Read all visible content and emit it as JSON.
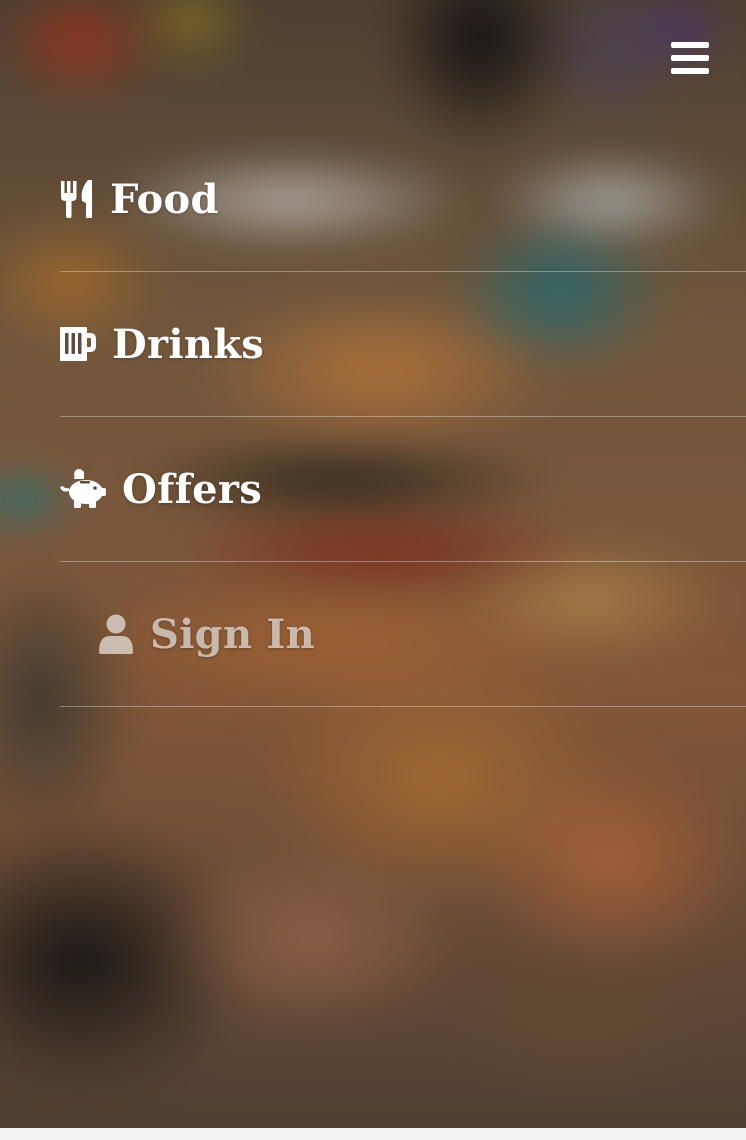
{
  "nav": {
    "menu_toggle_icon": "hamburger-menu-icon",
    "items": [
      {
        "label": "Food",
        "icon": "fork-knife-icon"
      },
      {
        "label": "Drinks",
        "icon": "beer-mug-icon"
      },
      {
        "label": "Offers",
        "icon": "piggy-bank-icon"
      },
      {
        "label": "Sign In",
        "icon": "user-icon"
      }
    ]
  },
  "colors": {
    "text": "#ffffff",
    "muted_text": "#ebe4e1",
    "divider": "#ffffff"
  }
}
